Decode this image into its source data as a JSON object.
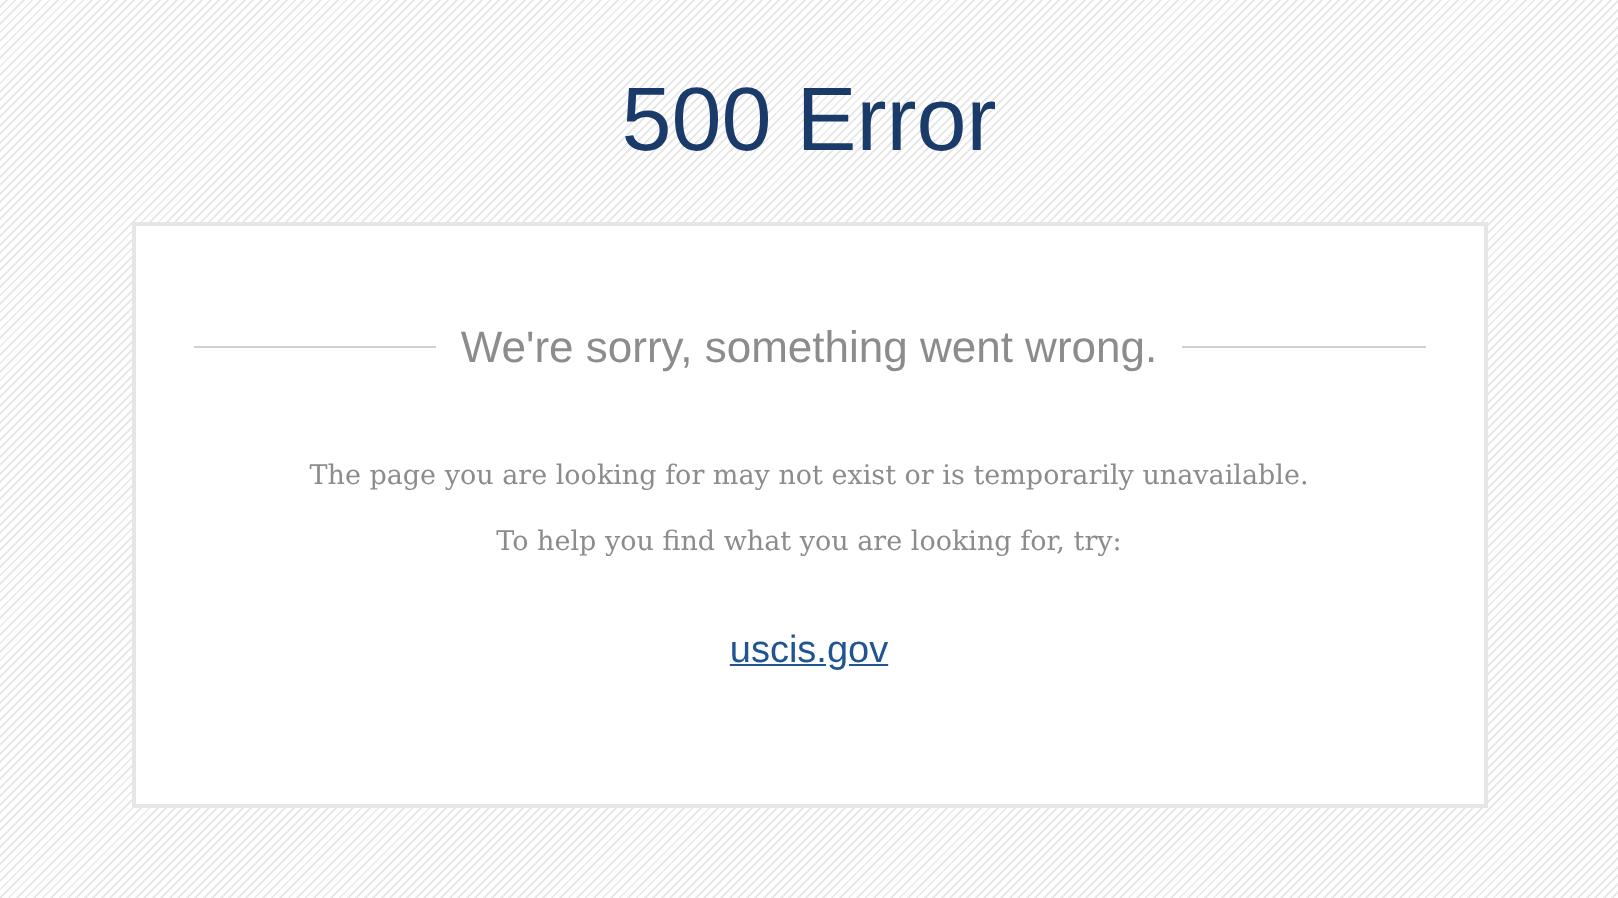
{
  "title": "500 Error",
  "card": {
    "heading": "We're sorry, something went wrong.",
    "paragraphs": [
      "The page you are looking for may not exist or is temporarily unavailable.",
      "To help you find what you are looking for, try:"
    ],
    "link": "uscis.gov"
  }
}
